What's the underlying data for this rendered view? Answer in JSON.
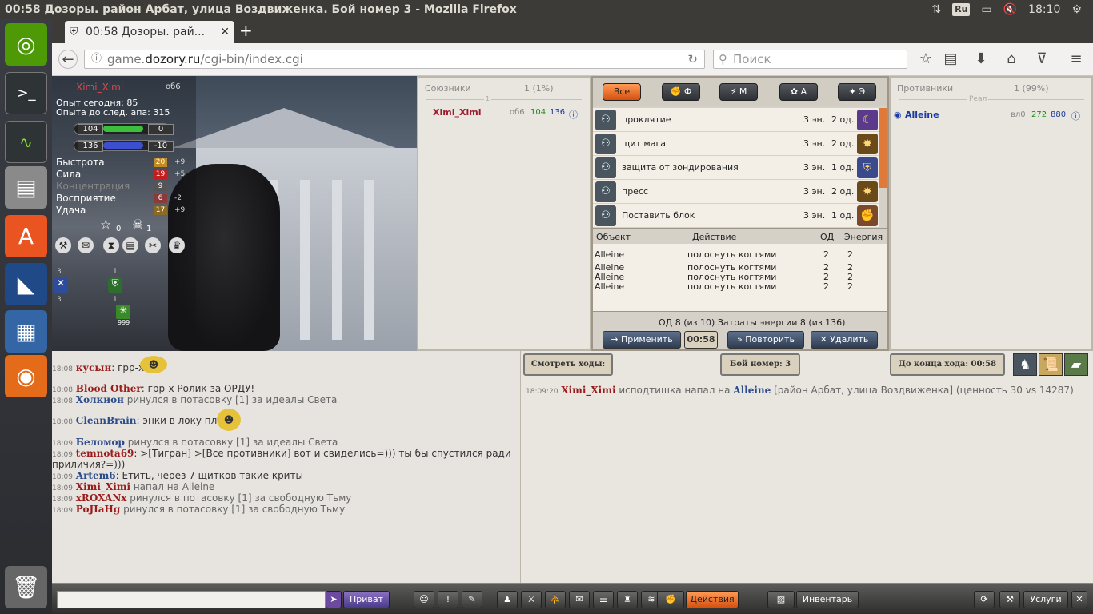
{
  "os": {
    "window_title": "00:58 Дозоры. район Арбат, улица Воздвиженка. Бой номер 3 - Mozilla Firefox",
    "keyboard": "Ru",
    "time": "18:10"
  },
  "browser": {
    "tab_title": "00:58 Дозоры. рай...",
    "url_prefix": "game.",
    "url_domain": "dozory.ru",
    "url_path": "/cgi-bin/index.cgi",
    "search_placeholder": "Поиск",
    "new_tab": "+",
    "tab_close": "✕"
  },
  "character": {
    "name": "Ximi_Ximi",
    "race": "об6",
    "exp_today": "Опыт сегодня: 85",
    "exp_next": "Опыта до след. апа: 315",
    "hp": "104",
    "hp_extra": "0",
    "mp": "136",
    "mp_extra": "-10",
    "stats": [
      {
        "label": "Быстрота",
        "value": "20",
        "bonus": "+9",
        "color": "#c08a28"
      },
      {
        "label": "Сила",
        "value": "19",
        "bonus": "+5",
        "color": "#c01f1f"
      },
      {
        "label": "Концентрация",
        "value": "9",
        "bonus": "",
        "color": "#555"
      },
      {
        "label": "Восприятие",
        "value": "6",
        "bonus": "-2",
        "color": "#8b3a3a"
      },
      {
        "label": "Удача",
        "value": "17",
        "bonus": "+9",
        "color": "#8b6a22"
      }
    ],
    "star_count": "0",
    "skull_count": "1",
    "badges": [
      {
        "top": "3",
        "bottom": "3"
      },
      {
        "top": "1",
        "bottom": "1"
      }
    ],
    "stack_count": "999"
  },
  "allies": {
    "title": "Союзники",
    "percent": "1 (1%)",
    "divider": "1",
    "member": {
      "name": "Ximi_Ximi",
      "race": "об6",
      "hp": "104",
      "mp": "136"
    }
  },
  "enemies": {
    "title": "Противники",
    "percent": "1 (99%)",
    "divider": "Реал",
    "member": {
      "name": "Alleine",
      "race": "вл0",
      "hp": "272",
      "mp": "880"
    }
  },
  "spell_tabs": {
    "all": "Все",
    "f": "Ф",
    "m": "М",
    "a": "А",
    "e": "Э"
  },
  "spells": [
    {
      "name": "проклятие",
      "energy": "3 эн.",
      "od": "2 од.",
      "icon": "☾",
      "bg": "#5b3a8c"
    },
    {
      "name": "щит мага",
      "energy": "3 эн.",
      "od": "2 од.",
      "icon": "✸",
      "bg": "#6a4a18"
    },
    {
      "name": "защита от зондирования",
      "energy": "3 эн.",
      "od": "1 од.",
      "icon": "⛨",
      "bg": "#3a4a8c"
    },
    {
      "name": "пресс",
      "energy": "3 эн.",
      "od": "2 од.",
      "icon": "✸",
      "bg": "#6a4a18"
    },
    {
      "name": "Поставить блок",
      "energy": "3 эн.",
      "od": "1 од.",
      "icon": "✊",
      "bg": "#7a4a2a"
    }
  ],
  "actions": {
    "headers": [
      "Объект",
      "Действие",
      "ОД",
      "Энергия"
    ],
    "rows": [
      {
        "object": "Alleine",
        "action": "полоснуть когтями",
        "od": "2",
        "energy": "2"
      },
      {
        "object": "Alleine",
        "action": "полоснуть когтями",
        "od": "2",
        "energy": "2"
      },
      {
        "object": "Alleine",
        "action": "полоснуть когтями",
        "od": "2",
        "energy": "2"
      },
      {
        "object": "Alleine",
        "action": "полоснуть когтями",
        "od": "2",
        "energy": "2"
      }
    ],
    "summary": "ОД 8 (из 10)  Затраты энергии 8 (из 136)",
    "apply": "Применить",
    "timer": "00:58",
    "repeat": "Повторить",
    "delete": "Удалить"
  },
  "chat": [
    {
      "time": "18:08",
      "name": "кусын",
      "name_color": "red",
      "text": ": грр-х",
      "sys": false
    },
    {
      "time": "18:08",
      "name": "Blood Other",
      "name_color": "red",
      "text": ": грр-х Ролик за ОРДУ!",
      "sys": false
    },
    {
      "time": "18:08",
      "name": "Холкион",
      "name_color": "blue",
      "text": " ринулся в потасовку [1] за идеалы Света",
      "sys": true
    },
    {
      "time": "18:08",
      "name": "CleanBrain",
      "name_color": "blue",
      "text": ": энки в локу плз",
      "sys": false
    },
    {
      "time": "18:09",
      "name": "Беломор",
      "name_color": "blue",
      "text": " ринулся в потасовку [1] за идеалы Света",
      "sys": true
    },
    {
      "time": "18:09",
      "name": "temnota69",
      "name_color": "red",
      "text": ": >[Тигран] >[Все противники] вот и свиделись=))) ты бы спустился ради приличия?=)))",
      "sys": false
    },
    {
      "time": "18:09",
      "name": "Artem6",
      "name_color": "blue",
      "text": ": Етить, через 7 щитков такие криты",
      "sys": false
    },
    {
      "time": "18:09",
      "name": "Ximi_Ximi",
      "name_color": "red",
      "text": " напал на Alleine",
      "sys": true
    },
    {
      "time": "18:09",
      "name": "xROXANx",
      "name_color": "red",
      "text": " ринулся в потасовку [1] за свободную Тьму",
      "sys": true
    },
    {
      "time": "18:09",
      "name": "PoJIaHg",
      "name_color": "red",
      "text": " ринулся в потасовку [1] за свободную Тьму",
      "sys": true
    }
  ],
  "log": {
    "watch": "Смотреть ходы:",
    "fight": "Бой номер: 3",
    "until": "До конца хода: 00:58",
    "entry": {
      "time": "18:09:20",
      "attacker": "Ximi_Ximi",
      "verb": " исподтишка напал на ",
      "target": "Alleine",
      "rest": " [район Арбат, улица Воздвиженка] (ценность 30 vs 14287)"
    }
  },
  "bottom": {
    "private": "Приват",
    "actions": "Действия",
    "inventory": "Инвентарь",
    "services": "Услуги"
  }
}
